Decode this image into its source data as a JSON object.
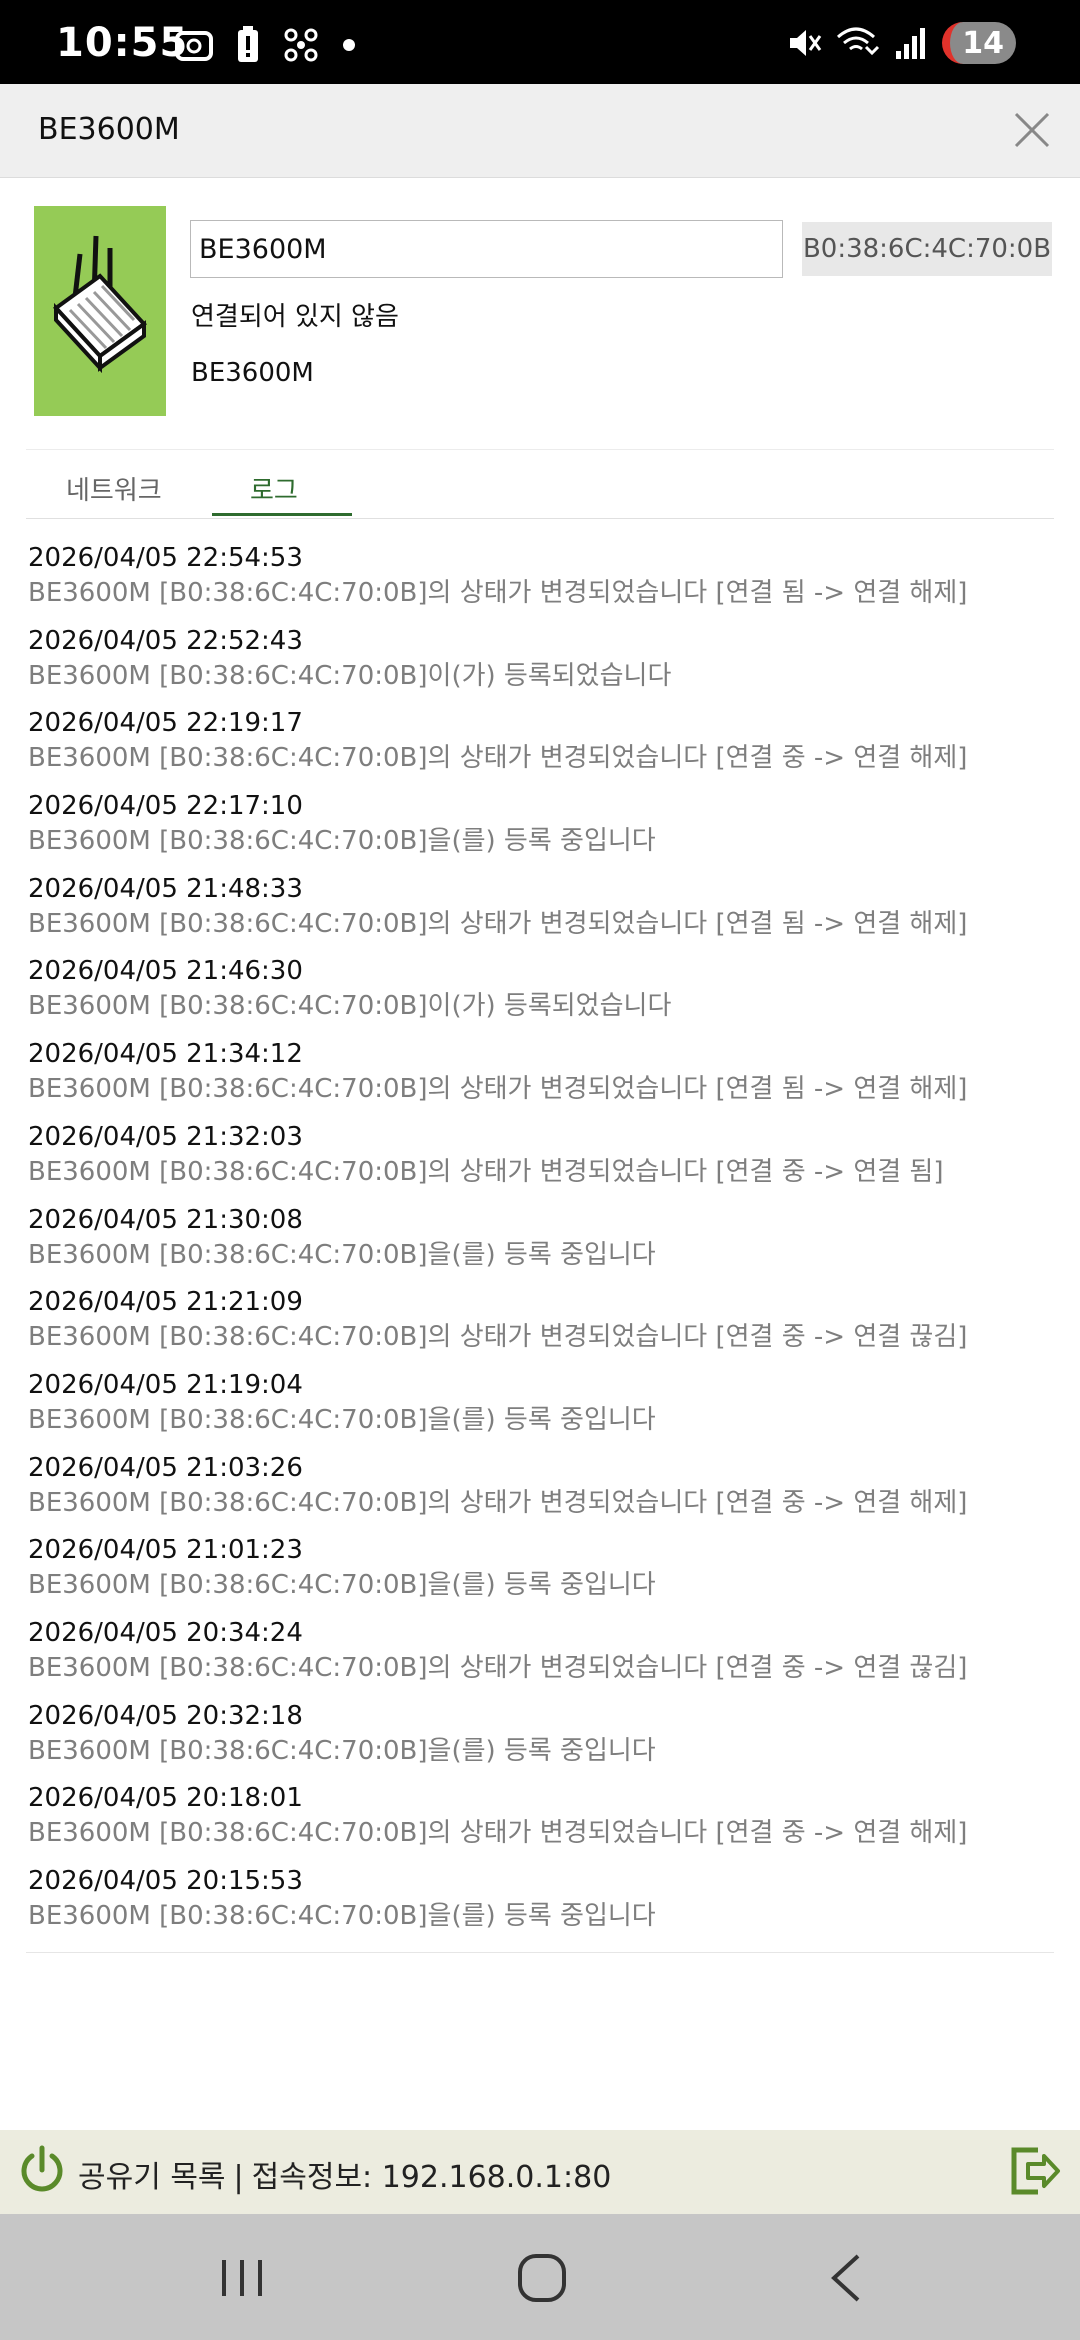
{
  "status_bar": {
    "time": "10:55",
    "badge_count": "14",
    "left_icons": [
      "screenshot-icon",
      "battery-alert-icon",
      "fan-icon",
      "dot-icon"
    ],
    "right_icons": [
      "mute-icon",
      "wifi-call-icon",
      "signal-icon"
    ]
  },
  "header": {
    "title": "BE3600M"
  },
  "device": {
    "name_value": "BE3600M",
    "mac": "B0:38:6C:4C:70:0B",
    "status": "연결되어 있지 않음",
    "model": "BE3600M",
    "card_color": "#95cb56"
  },
  "tabs": {
    "network": "네트워크",
    "log": "로그",
    "active": "log",
    "active_color": "#2e6b2e"
  },
  "logs": [
    {
      "time": "2026/04/05 22:54:53",
      "msg": "BE3600M [B0:38:6C:4C:70:0B]의 상태가 변경되었습니다 [연결 됨 -> 연결 해제]"
    },
    {
      "time": "2026/04/05 22:52:43",
      "msg": "BE3600M [B0:38:6C:4C:70:0B]이(가) 등록되었습니다"
    },
    {
      "time": "2026/04/05 22:19:17",
      "msg": "BE3600M [B0:38:6C:4C:70:0B]의 상태가 변경되었습니다 [연결 중 -> 연결 해제]"
    },
    {
      "time": "2026/04/05 22:17:10",
      "msg": "BE3600M [B0:38:6C:4C:70:0B]을(를) 등록 중입니다"
    },
    {
      "time": "2026/04/05 21:48:33",
      "msg": "BE3600M [B0:38:6C:4C:70:0B]의 상태가 변경되었습니다 [연결 됨 -> 연결 해제]"
    },
    {
      "time": "2026/04/05 21:46:30",
      "msg": "BE3600M [B0:38:6C:4C:70:0B]이(가) 등록되었습니다"
    },
    {
      "time": "2026/04/05 21:34:12",
      "msg": "BE3600M [B0:38:6C:4C:70:0B]의 상태가 변경되었습니다 [연결 됨 -> 연결 해제]"
    },
    {
      "time": "2026/04/05 21:32:03",
      "msg": "BE3600M [B0:38:6C:4C:70:0B]의 상태가 변경되었습니다 [연결 중 -> 연결 됨]"
    },
    {
      "time": "2026/04/05 21:30:08",
      "msg": "BE3600M [B0:38:6C:4C:70:0B]을(를) 등록 중입니다"
    },
    {
      "time": "2026/04/05 21:21:09",
      "msg": "BE3600M [B0:38:6C:4C:70:0B]의 상태가 변경되었습니다 [연결 중 -> 연결 끊김]"
    },
    {
      "time": "2026/04/05 21:19:04",
      "msg": "BE3600M [B0:38:6C:4C:70:0B]을(를) 등록 중입니다"
    },
    {
      "time": "2026/04/05 21:03:26",
      "msg": "BE3600M [B0:38:6C:4C:70:0B]의 상태가 변경되었습니다 [연결 중 -> 연결 해제]"
    },
    {
      "time": "2026/04/05 21:01:23",
      "msg": "BE3600M [B0:38:6C:4C:70:0B]을(를) 등록 중입니다"
    },
    {
      "time": "2026/04/05 20:34:24",
      "msg": "BE3600M [B0:38:6C:4C:70:0B]의 상태가 변경되었습니다 [연결 중 -> 연결 끊김]"
    },
    {
      "time": "2026/04/05 20:32:18",
      "msg": "BE3600M [B0:38:6C:4C:70:0B]을(를) 등록 중입니다"
    },
    {
      "time": "2026/04/05 20:18:01",
      "msg": "BE3600M [B0:38:6C:4C:70:0B]의 상태가 변경되었습니다 [연결 중 -> 연결 해제]"
    },
    {
      "time": "2026/04/05 20:15:53",
      "msg": "BE3600M [B0:38:6C:4C:70:0B]을(를) 등록 중입니다"
    }
  ],
  "bottom_bar": {
    "router_list": "공유기 목록",
    "separator": "|",
    "connection_info": "접속정보: 192.168.0.1:80",
    "accent_color": "#5a8a2a"
  },
  "nav_bar": {
    "buttons": [
      "recents-icon",
      "home-icon",
      "back-icon"
    ]
  }
}
